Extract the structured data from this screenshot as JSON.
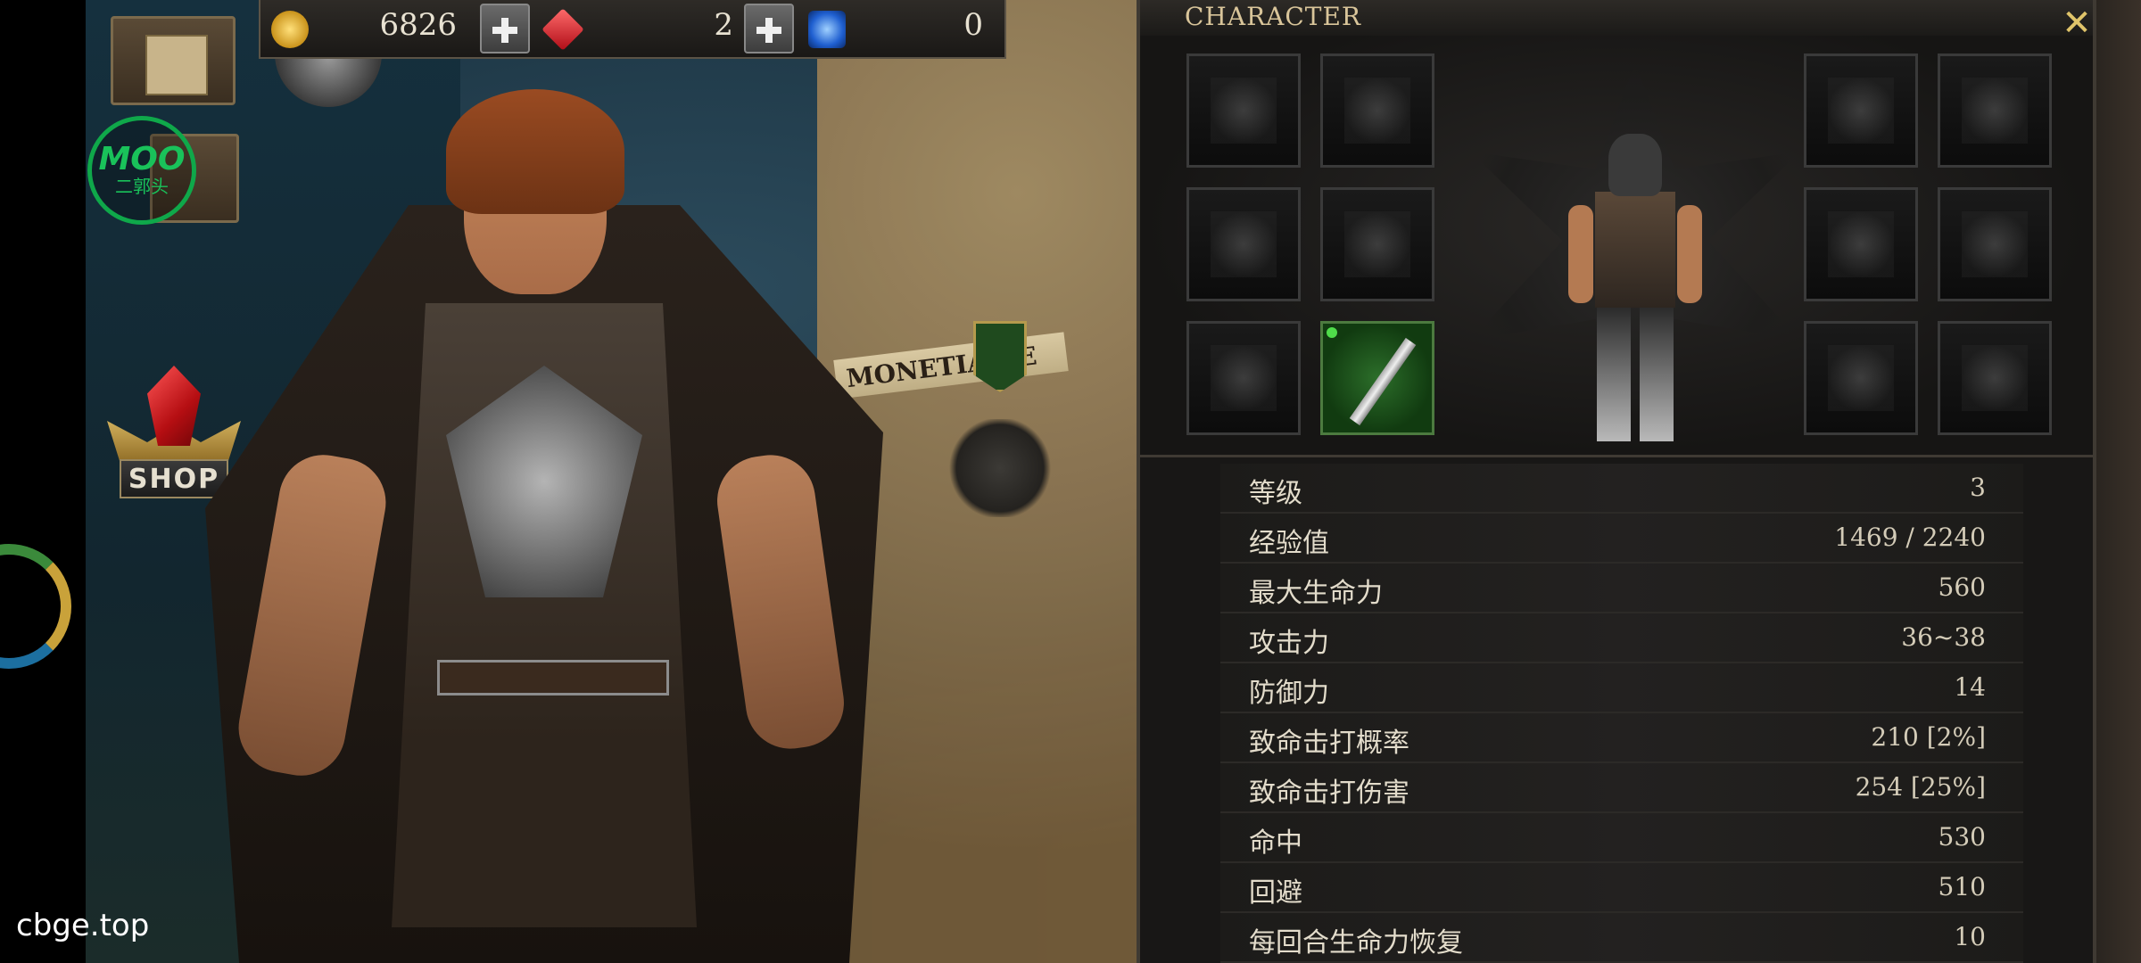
{
  "currency": {
    "gold": "6826",
    "rubies": "2",
    "sapphires": "0",
    "colors": {
      "gold": "#e6b422",
      "ruby": "#d01f2a",
      "sapphire": "#1f63d9"
    }
  },
  "sidebar": {
    "moo_badge": {
      "title": "MOO",
      "subtitle": "二郭头"
    },
    "shop_label": "SHOP"
  },
  "map": {
    "region_label": "MONETIA  NE",
    "region_label_2": "A"
  },
  "watermark": "cbge.top",
  "character": {
    "title": "CHARACTER",
    "close_icon": "✕",
    "equipment_slots": [
      {
        "slot": "cloak",
        "equipped": false
      },
      {
        "slot": "cape",
        "equipped": false
      },
      {
        "slot": "gloves",
        "equipped": false
      },
      {
        "slot": "armor",
        "equipped": false
      },
      {
        "slot": "boots",
        "equipped": false
      },
      {
        "slot": "weapon",
        "equipped": true
      },
      {
        "slot": "amulet-star",
        "equipped": false
      },
      {
        "slot": "necklace",
        "equipped": false
      },
      {
        "slot": "pants",
        "equipped": false
      },
      {
        "slot": "ring-1",
        "equipped": false
      },
      {
        "slot": "offhand",
        "equipped": false
      },
      {
        "slot": "ring-2",
        "equipped": false
      }
    ],
    "stats": [
      {
        "name": "等级",
        "value": "3"
      },
      {
        "name": "经验值",
        "value": "1469 / 2240"
      },
      {
        "name": "最大生命力",
        "value": "560"
      },
      {
        "name": "攻击力",
        "value": "36~38"
      },
      {
        "name": "防御力",
        "value": "14"
      },
      {
        "name": "致命击打概率",
        "value": "210 [2%]"
      },
      {
        "name": "致命击打伤害",
        "value": "254 [25%]"
      },
      {
        "name": "命中",
        "value": "530"
      },
      {
        "name": "回避",
        "value": "510"
      },
      {
        "name": "每回合生命力恢复",
        "value": "10"
      }
    ]
  }
}
